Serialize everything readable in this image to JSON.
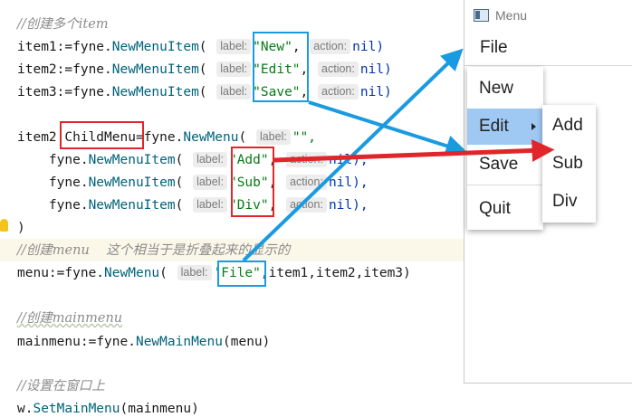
{
  "editor": {
    "lines": {
      "c1": "//创建多个item",
      "i1_pre": "item1:=",
      "i2_pre": "item2:=",
      "i3_pre": "item3:=",
      "fyne_dot": "fyne.",
      "new_menu_item": "NewMenuItem",
      "open_paren": "( ",
      "label_hint": "label:",
      "action_hint": "action:",
      "str_new": "\"New\"",
      "str_edit": "\"Edit\"",
      "str_save": "\"Save\"",
      "comma": ", ",
      "nil_close": "nil)",
      "item2_childmenu_pre": "item2.",
      "childmenu": "ChildMenu",
      "childmenu_assign": "=",
      "new_menu": "NewMenu",
      "str_empty": "\"\",",
      "indent": "    ",
      "str_add": "\"Add\"",
      "str_sub": "\"Sub\"",
      "str_div": "\"Div\"",
      "nil_close_comma": "nil),",
      "close_paren": ")",
      "c2": "//创建menu    这个相当于是折叠起来的显示的",
      "menu_pre": "menu:=",
      "str_file": "'File\"",
      "menu_args": ",item1,item2,item3)",
      "c3": "//创建mainmenu",
      "mainmenu_pre": "mainmenu:=",
      "new_main_menu": "NewMainMenu",
      "mainmenu_args": "(menu)",
      "c4": "//设置在窗口上",
      "w_pre": "w.",
      "set_main_menu": "SetMainMenu",
      "set_args": "(mainmenu)"
    }
  },
  "window": {
    "title": "Menu",
    "menubar": [
      "File"
    ],
    "file_menu": [
      "New",
      "Edit",
      "Save",
      "Quit"
    ],
    "edit_submenu": [
      "Add",
      "Sub",
      "Div"
    ],
    "active_item": "Edit"
  },
  "colors": {
    "annotation_blue": "#1a9ae0",
    "annotation_red": "#e0262b",
    "menu_highlight": "#9fc9f2"
  }
}
